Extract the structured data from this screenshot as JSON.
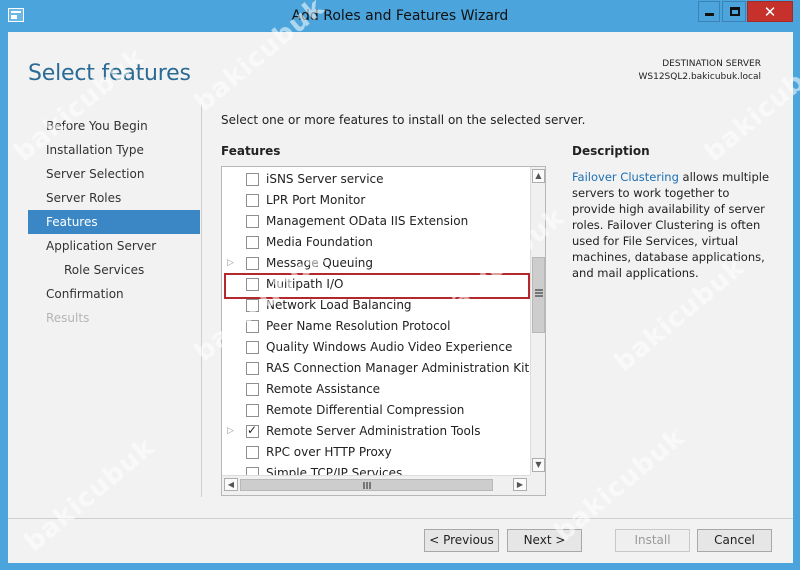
{
  "window": {
    "title": "Add Roles and Features Wizard",
    "close_glyph": "✕"
  },
  "header": {
    "page_title": "Select features",
    "destination_label": "DESTINATION SERVER",
    "destination_server": "WS12SQL2.bakicubuk.local"
  },
  "nav": {
    "items": [
      {
        "label": "Before You Begin",
        "state": "normal"
      },
      {
        "label": "Installation Type",
        "state": "normal"
      },
      {
        "label": "Server Selection",
        "state": "normal"
      },
      {
        "label": "Server Roles",
        "state": "normal"
      },
      {
        "label": "Features",
        "state": "active"
      },
      {
        "label": "Application Server",
        "state": "normal"
      },
      {
        "label": "Role Services",
        "state": "sub"
      },
      {
        "label": "Confirmation",
        "state": "normal"
      },
      {
        "label": "Results",
        "state": "disabled"
      }
    ]
  },
  "main": {
    "instruction": "Select one or more features to install on the selected server.",
    "features_heading": "Features",
    "features": [
      {
        "label": "iSNS Server service",
        "checked": false,
        "expandable": false
      },
      {
        "label": "LPR Port Monitor",
        "checked": false,
        "expandable": false
      },
      {
        "label": "Management OData IIS Extension",
        "checked": false,
        "expandable": false
      },
      {
        "label": "Media Foundation",
        "checked": false,
        "expandable": false
      },
      {
        "label": "Message Queuing",
        "checked": false,
        "expandable": true
      },
      {
        "label": "Multipath I/O",
        "checked": false,
        "expandable": false,
        "highlighted": true
      },
      {
        "label": "Network Load Balancing",
        "checked": false,
        "expandable": false
      },
      {
        "label": "Peer Name Resolution Protocol",
        "checked": false,
        "expandable": false
      },
      {
        "label": "Quality Windows Audio Video Experience",
        "checked": false,
        "expandable": false
      },
      {
        "label": "RAS Connection Manager Administration Kit (CMA",
        "checked": false,
        "expandable": false
      },
      {
        "label": "Remote Assistance",
        "checked": false,
        "expandable": false
      },
      {
        "label": "Remote Differential Compression",
        "checked": false,
        "expandable": false
      },
      {
        "label": "Remote Server Administration Tools",
        "checked": true,
        "expandable": true
      },
      {
        "label": "RPC over HTTP Proxy",
        "checked": false,
        "expandable": false
      },
      {
        "label": "Simple TCP/IP Services",
        "checked": false,
        "expandable": false
      }
    ],
    "description_heading": "Description",
    "description_link": "Failover Clustering",
    "description_text": " allows multiple servers to work together to provide high availability of server roles. Failover Clustering is often used for File Services, virtual machines, database applications, and mail applications."
  },
  "buttons": {
    "previous": "< Previous",
    "next": "Next >",
    "install": "Install",
    "cancel": "Cancel"
  },
  "watermark": {
    "text": "bakicubuk"
  }
}
